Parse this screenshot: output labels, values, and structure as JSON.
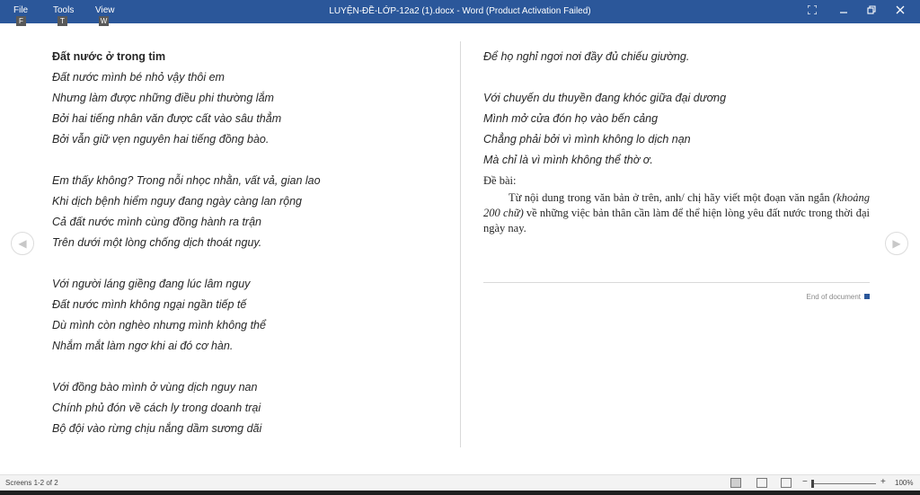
{
  "menu": [
    {
      "label": "File",
      "key": "F"
    },
    {
      "label": "Tools",
      "key": "T"
    },
    {
      "label": "View",
      "key": "W"
    }
  ],
  "window_title": "LUYỆN-ĐỀ-LỚP-12a2 (1).docx - Word (Product Activation Failed)",
  "left_page": {
    "heading": "Đất nước ở trong tim",
    "lines": [
      "Đất nước mình bé nhỏ vậy thôi em",
      "Nhưng làm được những điều phi thường lắm",
      "Bởi hai tiếng nhân văn được cất vào sâu thẳm",
      "Bởi vẫn giữ vẹn nguyên hai tiếng đồng bào.",
      "Em thấy không? Trong nỗi nhọc nhằn, vất vả, gian lao",
      "Khi dịch bệnh hiểm nguy đang ngày càng lan rộng",
      "Cả đất nước mình cùng đồng hành ra trận",
      "Trên dưới một lòng chống dịch thoát nguy.",
      "Với người láng giềng đang lúc lâm nguy",
      "Đất nước mình không ngại ngần tiếp tế",
      "Dù mình còn nghèo nhưng mình không thể",
      "Nhắm mắt làm ngơ khi ai đó cơ hàn.",
      "Với đồng bào mình ở vùng dịch nguy nan",
      "Chính phủ đón về cách ly trong doanh trại",
      "Bộ đội vào rừng chịu nắng dầm sương dãi"
    ]
  },
  "right_page": {
    "lines": [
      "Để họ nghỉ ngơi nơi đầy đủ chiếu giường.",
      "Với chuyến du thuyền đang khóc giữa đại dương",
      "Mình mở cửa đón họ vào bến cảng",
      "Chẳng phải bởi vì mình không lo dịch nạn",
      "Mà chỉ là vì mình không thể thờ ơ."
    ],
    "task_label": "Đề bài:",
    "prompt_before": "Từ nội dung trong văn bản ở trên, anh/ chị hãy viết một đoạn văn ngắn ",
    "prompt_italic": "(khoảng 200 chữ)",
    "prompt_after": " về những việc bản thân cần làm để thể hiện lòng yêu đất nước trong thời đại ngày nay.",
    "end_of_document": "End of document"
  },
  "statusbar": {
    "screens": "Screens 1-2 of 2",
    "zoom": "100%",
    "zoom_minus": "−",
    "zoom_plus": "+"
  },
  "colors": {
    "titlebar": "#2b579a",
    "text": "#262626"
  }
}
